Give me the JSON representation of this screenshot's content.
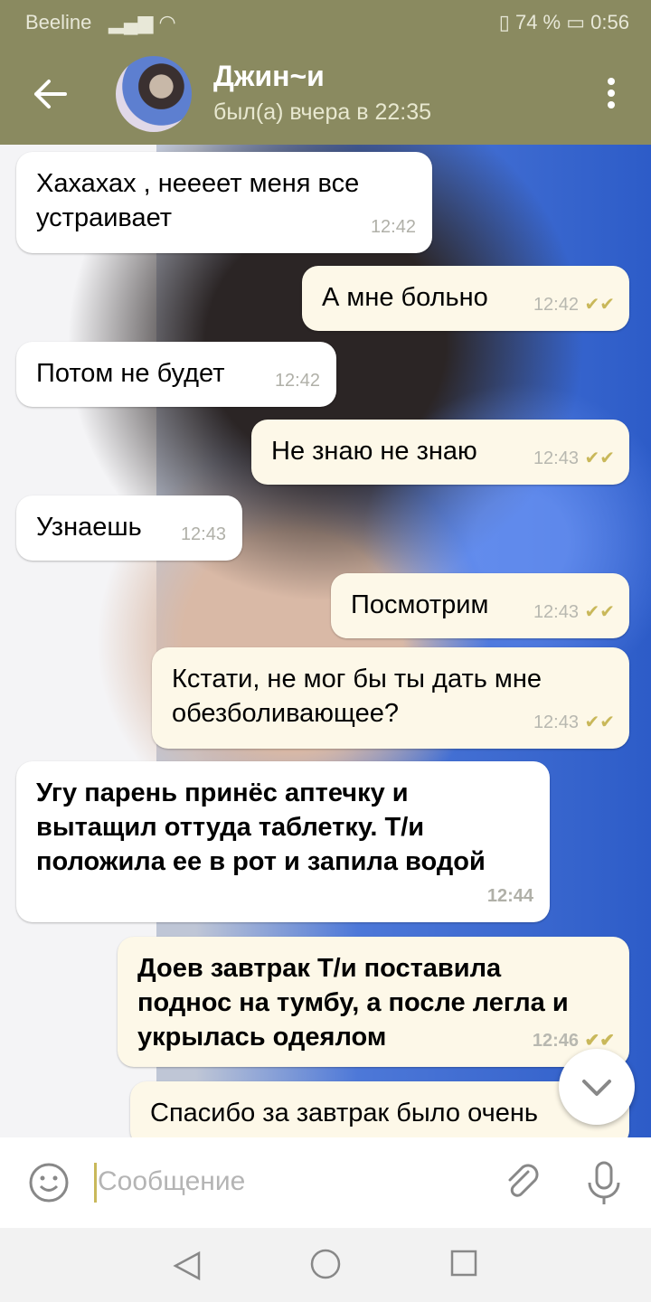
{
  "status_bar": {
    "carrier": "Beeline",
    "battery_percent": "74 %",
    "time": "0:56"
  },
  "header": {
    "title": "Джин~и",
    "subtitle": "был(а) вчера в 22:35",
    "accent": "#8a8a60"
  },
  "messages": [
    {
      "dir": "in",
      "text": "Хахахах , нееeет меня все\nустраивает",
      "time": "12:42"
    },
    {
      "dir": "out",
      "text": "А мне больно",
      "time": "12:42"
    },
    {
      "dir": "in",
      "text": "Потом не будет",
      "time": "12:42"
    },
    {
      "dir": "out",
      "text": "Не знаю не знаю",
      "time": "12:43"
    },
    {
      "dir": "in",
      "text": "Узнаешь",
      "time": "12:43"
    },
    {
      "dir": "out",
      "text": "Посмотрим",
      "time": "12:43"
    },
    {
      "dir": "out",
      "text": "Кстати, не мог бы ты дать мне\nобезболивающее?",
      "time": "12:43"
    },
    {
      "dir": "in",
      "text": "Угу парень принёс аптечку и\nвытащил оттуда таблетку. Т/и\nположила ее в рот и запила водой",
      "time": "12:44"
    },
    {
      "dir": "out",
      "text": "Доев завтрак Т/и поставила\nподнос на тумбу, а после легла и\nукрылась одеялом",
      "time": "12:46"
    },
    {
      "dir": "out",
      "text": "Спасибо за завтрак было очень",
      "time": ""
    }
  ],
  "input": {
    "placeholder": "Сообщение"
  },
  "icons": {
    "back": "back-arrow-icon",
    "menu": "more-vert-icon",
    "emoji": "emoji-icon",
    "attach": "paperclip-icon",
    "mic": "microphone-icon",
    "scroll": "chevron-down-icon"
  }
}
